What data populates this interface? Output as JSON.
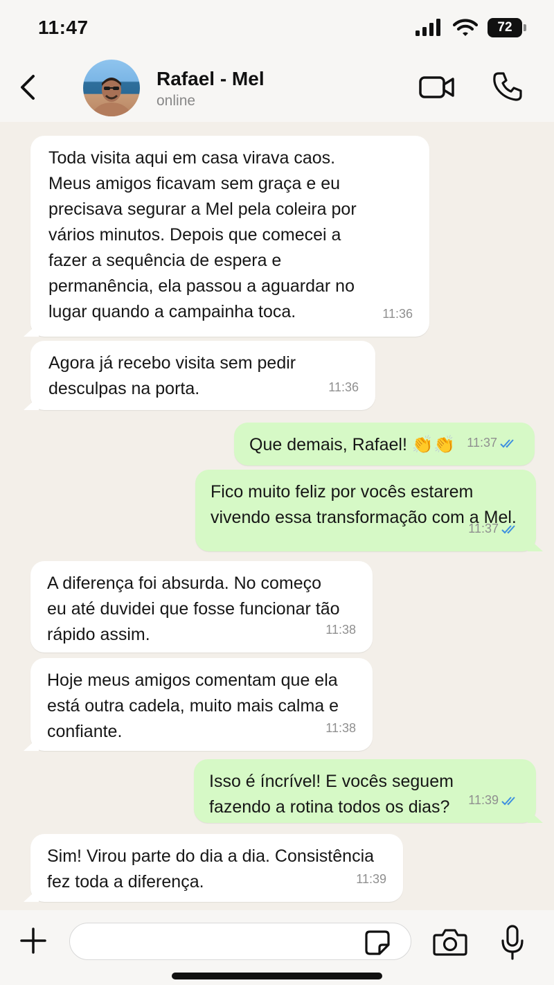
{
  "status_bar": {
    "time": "11:47",
    "battery": "72"
  },
  "header": {
    "contact_name": "Rafael - Mel",
    "contact_status": "online"
  },
  "messages": [
    {
      "direction": "in",
      "text": "Toda visita aqui em casa virava caos.\nMeus amigos ficavam sem graça e eu\nprecisava segurar a Mel pela coleira por\nvários minutos. Depois que comecei a\nfazer a sequência de espera e\npermanência, ela passou a aguardar no\nlugar quando a campainha toca.",
      "time": "11:36"
    },
    {
      "direction": "in",
      "text": "Agora já recebo visita sem pedir\ndesculpas na porta.",
      "time": "11:36"
    },
    {
      "direction": "out",
      "text": "Que demais, Rafael! 👏👏",
      "time": "11:37",
      "status": "read"
    },
    {
      "direction": "out",
      "text": "Fico muito feliz por vocês estarem\nvivendo essa transformação com a Mel.",
      "time": "11:37",
      "status": "read"
    },
    {
      "direction": "in",
      "text": "A diferença foi absurda. No começo\neu até duvidei que fosse funcionar tão\nrápido assim.",
      "time": "11:38"
    },
    {
      "direction": "in",
      "text": "Hoje meus amigos comentam que ela\nestá outra cadela, muito mais calma e\nconfiante.",
      "time": "11:38"
    },
    {
      "direction": "out",
      "text": "Isso é íncrível! E vocês seguem\nfazendo a rotina todos os dias?",
      "time": "11:39",
      "status": "read"
    },
    {
      "direction": "in",
      "text": "Sim! Virou parte do dia a dia. Consistência\nfez toda a diferença.",
      "time": "11:39"
    }
  ],
  "input": {
    "value": "",
    "placeholder": ""
  },
  "colors": {
    "incoming_bubble": "#ffffff",
    "outgoing_bubble": "#d6f9c6",
    "read_check": "#3d8fe0",
    "chat_background": "#f3efe9"
  },
  "icons": {
    "back": "chevron-left-icon",
    "video": "video-camera-icon",
    "call": "phone-icon",
    "plus": "plus-icon",
    "sticker": "sticker-icon",
    "camera": "camera-icon",
    "mic": "microphone-icon"
  }
}
